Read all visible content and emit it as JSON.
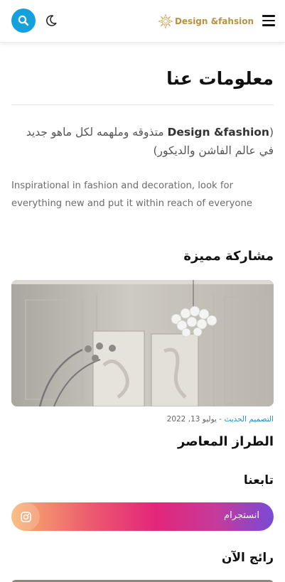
{
  "header": {
    "logo_text": "Design &fahsion",
    "icons": [
      "search-icon",
      "moon-icon",
      "menu-icon"
    ],
    "accent_color": "#14a0dd",
    "logo_color": "#b99142"
  },
  "about": {
    "title": "معلومات عنا",
    "paren_open": "(",
    "brand": "Design &fashion",
    "text_ar": "متذوقه وملهمه لكل ماهو جديد في عالم الفاشن والديكور)",
    "text_en": "Inspirational in fashion and decoration, look for everything new and put it within reach of everyone"
  },
  "featured": {
    "title": "مشاركة مميزة",
    "category": "التصميم الحديث",
    "separator": "-",
    "date": "يوليو 13, 2022",
    "post_title": "الطراز المعاصر"
  },
  "follow": {
    "title": "تابعنا",
    "instagram_label": "انستجرام"
  },
  "trending": {
    "title": "رائج الآن"
  }
}
